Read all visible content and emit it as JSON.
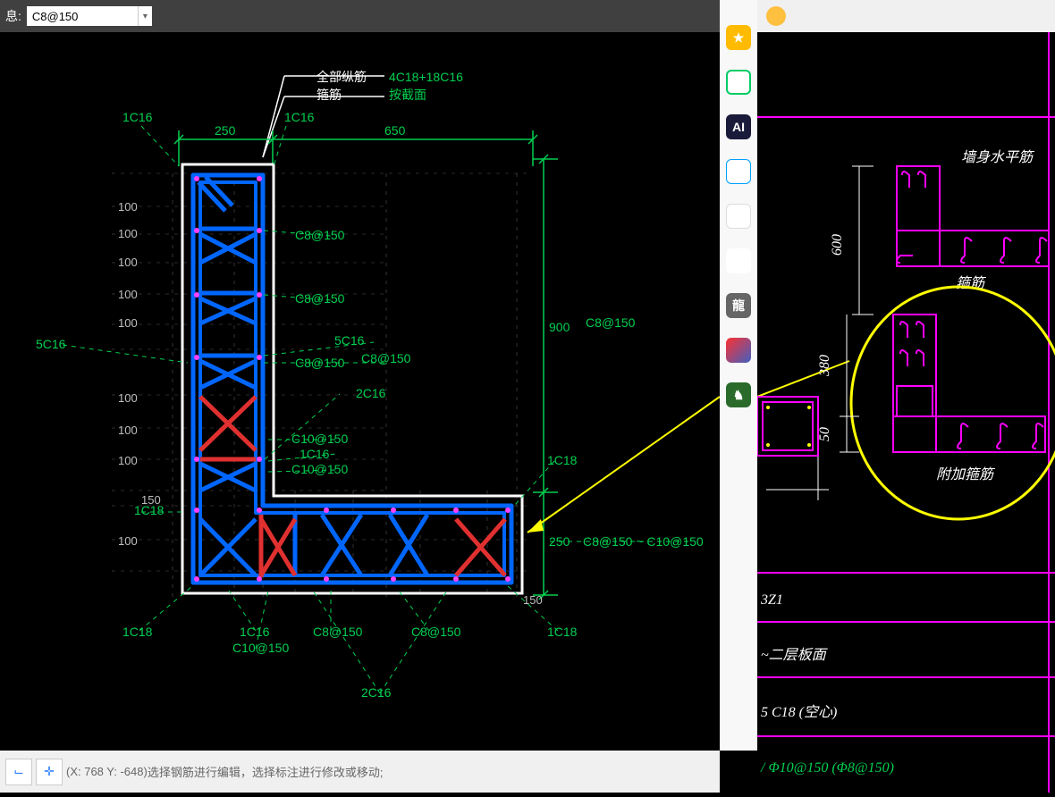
{
  "topbar": {
    "label": "息:",
    "input_value": "C8@150"
  },
  "header_rebar": {
    "all_label": "全部纵筋",
    "all_value": "4C18+18C16",
    "stirrup_label": "箍筋",
    "stirrup_value": "按截面"
  },
  "dims": {
    "top_w1": "250",
    "top_w2": "650",
    "right_h": "900",
    "right2_h": "250",
    "grid100": "100",
    "grid150": "150"
  },
  "labels": {
    "c8_150": "C8@150",
    "c10_150": "C10@150",
    "c1_16": "1C16",
    "c2_16": "2C16",
    "c5_16": "5C16",
    "c1_18": "1C18",
    "right_line": "C8@150 ~ C10@150",
    "bottom_extra": "C10@150"
  },
  "right_panel": {
    "title_top": "墙身水平筋",
    "stirrup_label": "箍筋",
    "extra_stirrup": "附加箍筋",
    "dim600": "600",
    "dim_380": "380",
    "dim_50": "50",
    "id": "3Z1",
    "layer": "~二层板面",
    "rebar1": "5 C18 (空心)",
    "rebar2": "/ Φ10@150 (Φ8@150)"
  },
  "statusbar": {
    "coord": "(X: 768 Y: -648)",
    "msg": "选择钢筋进行编辑，选择标注进行修改或移动;"
  }
}
